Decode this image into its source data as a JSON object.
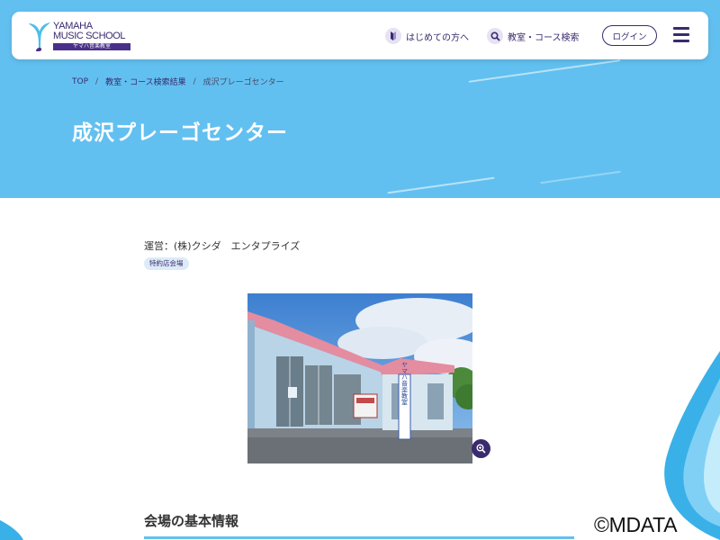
{
  "header": {
    "logo_line1": "YAMAHA",
    "logo_line2": "MUSIC SCHOOL",
    "logo_sub": "ヤマハ音楽教室",
    "nav": [
      {
        "label": "はじめての方へ",
        "icon": "beginner-icon"
      },
      {
        "label": "教室・コース検索",
        "icon": "search-icon"
      }
    ],
    "login_label": "ログイン",
    "menu_icon": "hamburger-menu-icon"
  },
  "breadcrumb": {
    "items": [
      "TOP",
      "教室・コース検索結果"
    ],
    "separator": "/",
    "current": "成沢プレーゴセンター"
  },
  "page": {
    "title": "成沢プレーゴセンター",
    "operator": "運営：(株)クシダ　エンタプライズ",
    "tag": "特約店会場",
    "photo_sign_text": "ヤマハ音楽教室",
    "zoom_icon": "zoom-in-icon",
    "section_title": "会場の基本情報"
  },
  "watermark": "©MDATA",
  "colors": {
    "hero_bg": "#62c0f0",
    "brand_purple": "#3a2a6e",
    "tag_bg": "#dcebf7"
  }
}
